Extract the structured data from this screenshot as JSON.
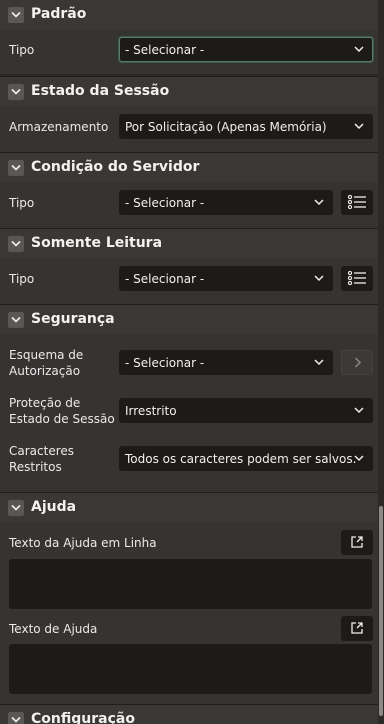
{
  "sections": {
    "padrao": {
      "title": "Padrão",
      "tipo_label": "Tipo",
      "tipo_value": "- Selecionar -"
    },
    "estado": {
      "title": "Estado da Sessão",
      "armazenamento_label": "Armazenamento",
      "armazenamento_value": "Por Solicitação (Apenas Memória)"
    },
    "condicao": {
      "title": "Condição do Servidor",
      "tipo_label": "Tipo",
      "tipo_value": "- Selecionar -"
    },
    "somente": {
      "title": "Somente Leitura",
      "tipo_label": "Tipo",
      "tipo_value": "- Selecionar -"
    },
    "seguranca": {
      "title": "Segurança",
      "esquema_label_1": "Esquema de",
      "esquema_label_2": "Autorização",
      "esquema_value": "- Selecionar -",
      "protecao_label_1": "Proteção de",
      "protecao_label_2": "Estado de Sessão",
      "protecao_value": "Irrestrito",
      "caracteres_label_1": "Caracteres",
      "caracteres_label_2": "Restritos",
      "caracteres_value": "Todos os caracteres podem ser salvos."
    },
    "ajuda": {
      "title": "Ajuda",
      "linha_label": "Texto da Ajuda em Linha",
      "texto_label": "Texto de Ajuda"
    },
    "configuracao": {
      "title": "Configuração"
    }
  },
  "icons": {
    "collapse": "chevron-down-icon",
    "select": "chevron-down-icon",
    "list": "list-icon",
    "go": "chevron-right-icon",
    "expand": "expand-icon"
  },
  "colors": {
    "background": "#2b2a29",
    "section": "#363433",
    "field": "#1c1b1a",
    "focus": "#5a7a6a"
  }
}
